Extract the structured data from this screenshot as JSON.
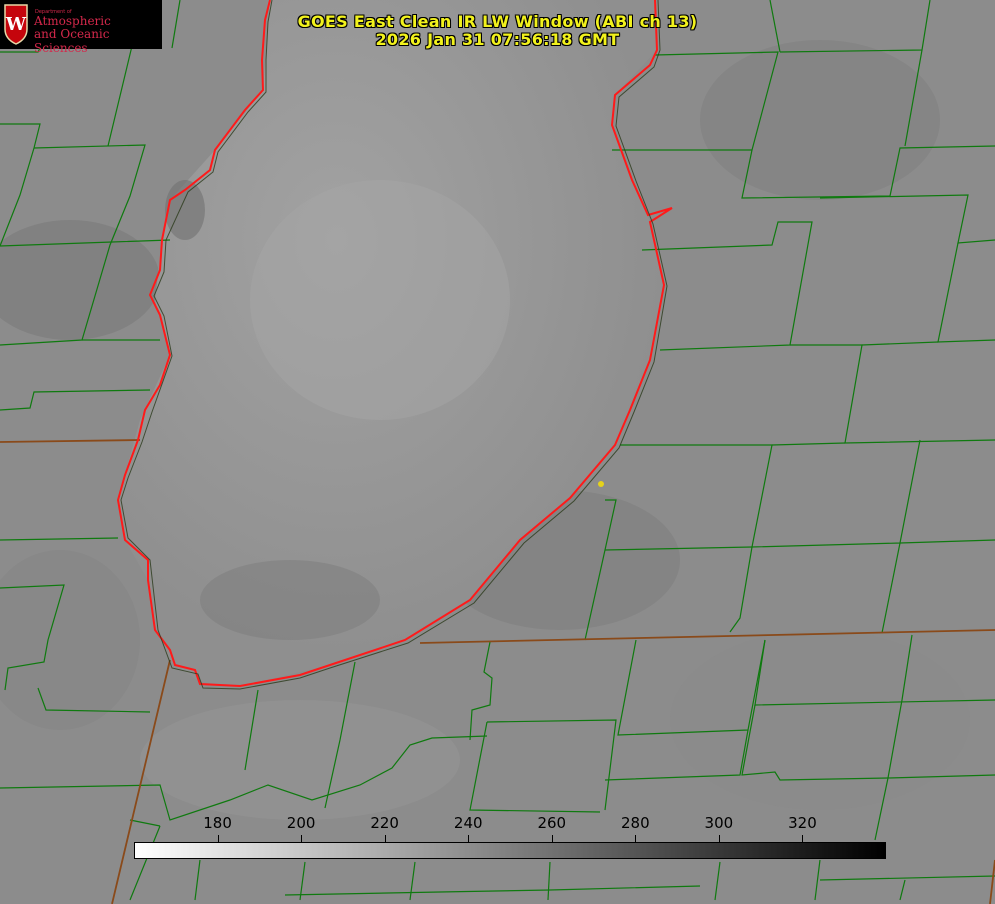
{
  "image": {
    "title": "GOES East Clean IR LW Window (ABI ch 13)",
    "timestamp": "2026 Jan 31 07:56:18 GMT",
    "colors": {
      "title": "#f2f21c",
      "lake_outline": "#ff1a1a",
      "county_lines": "#0f7a0f",
      "state_lines": "#8a4a1a",
      "marker": "#e5d21a"
    }
  },
  "logo": {
    "department": "Department of",
    "line1": "Atmospheric",
    "line2": "and Oceanic Sciences",
    "crest_letter": "W"
  },
  "colorbar": {
    "min": 160,
    "max": 340,
    "ticks": [
      "180",
      "200",
      "220",
      "240",
      "260",
      "280",
      "300",
      "320"
    ]
  }
}
